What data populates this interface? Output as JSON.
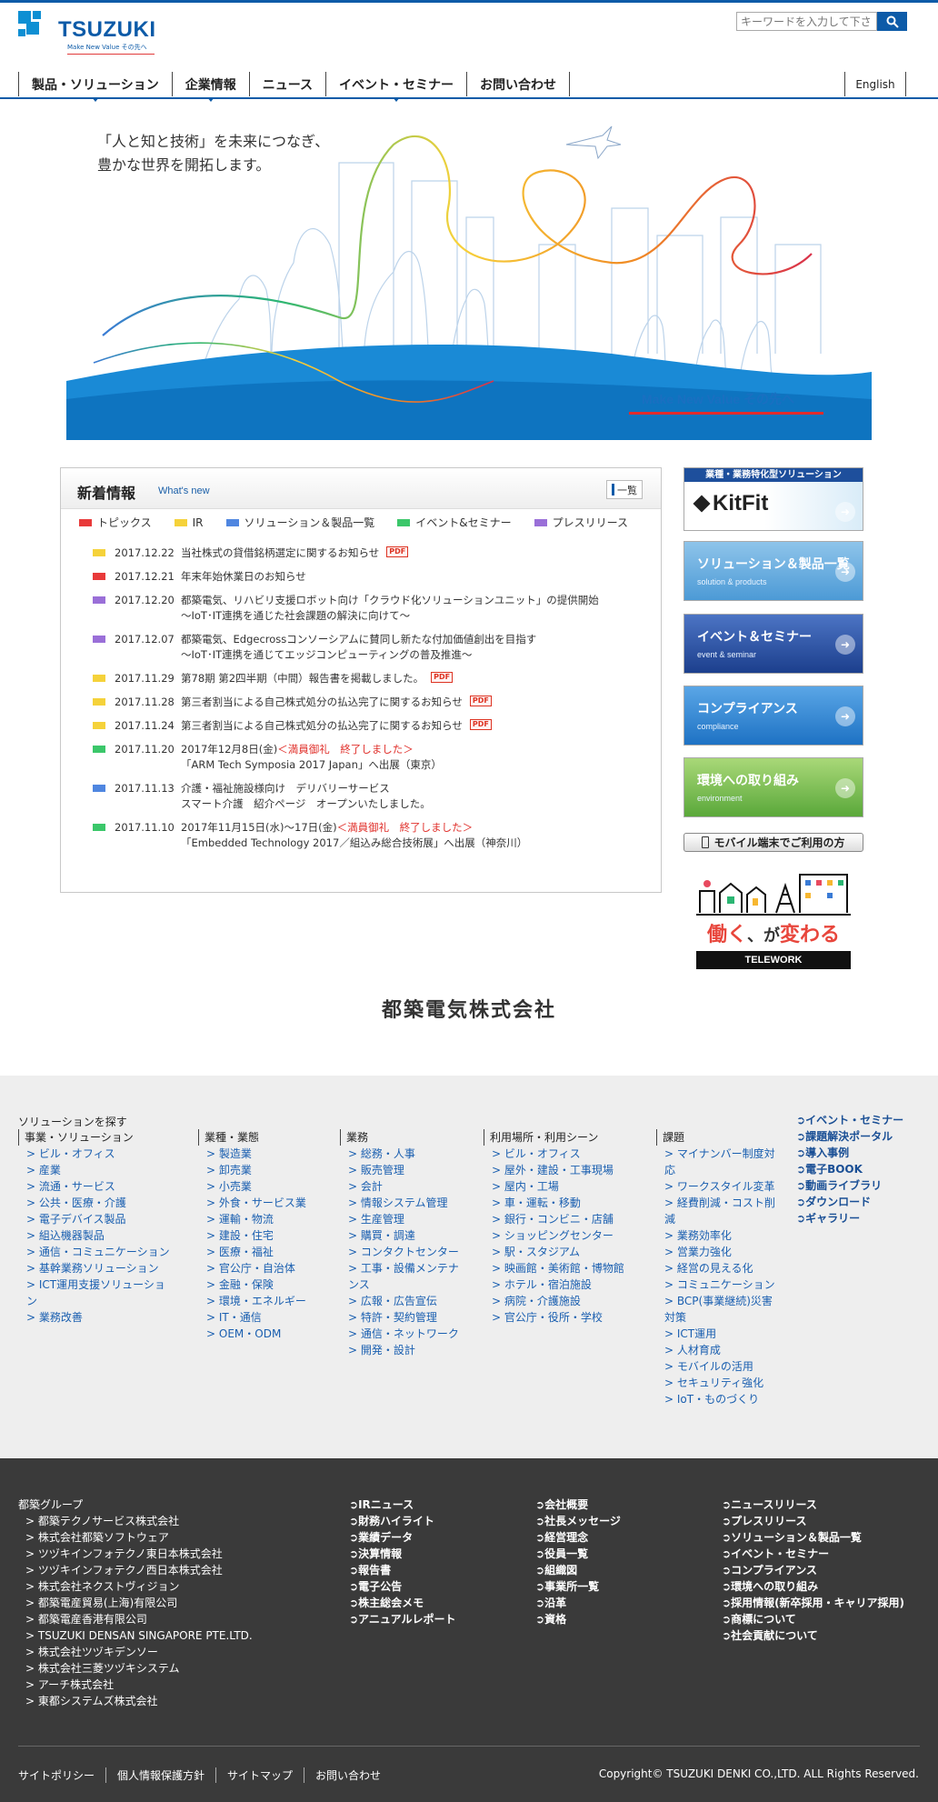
{
  "header": {
    "logo_text": "TSUZUKI",
    "logo_tagline": "Make New Value その先へ",
    "search_placeholder": "キーワードを入力して下さい",
    "english": "English"
  },
  "gnav": [
    "製品・ソリューション",
    "企業情報",
    "ニュース",
    "イベント・セミナー",
    "お問い合わせ"
  ],
  "hero": {
    "line1": "「人と知と技術」を未来につなぎ、",
    "line2": "豊かな世界を開拓します。",
    "tag": "Make New Value その先へ"
  },
  "news": {
    "title": "新着情報",
    "subtitle": "What's new",
    "list_button": "一覧",
    "categories": [
      {
        "label": "トピックス",
        "color": "#e83a3a"
      },
      {
        "label": "IR",
        "color": "#f5d23a"
      },
      {
        "label": "ソリューション＆製品一覧",
        "color": "#4f86e0"
      },
      {
        "label": "イベント&セミナー",
        "color": "#3bc76a"
      },
      {
        "label": "プレスリリース",
        "color": "#9a6fd8"
      }
    ],
    "items": [
      {
        "color": "#f5d23a",
        "date": "2017.12.22",
        "line1": "当社株式の貸借銘柄選定に関するお知らせ",
        "pdf": "PDF"
      },
      {
        "color": "#e83a3a",
        "date": "2017.12.21",
        "line1": "年末年始休業日のお知らせ"
      },
      {
        "color": "#9a6fd8",
        "date": "2017.12.20",
        "line1": "都築電気、リハビリ支援ロボット向け「クラウド化ソリューションユニット」の提供開始",
        "line2": "～IoT･IT連携を通じた社会課題の解決に向けて～"
      },
      {
        "color": "#9a6fd8",
        "date": "2017.12.07",
        "line1": "都築電気、Edgecrossコンソーシアムに賛同し新たな付加価値創出を目指す",
        "line2": "～IoT･IT連携を通じてエッジコンピューティングの普及推進～"
      },
      {
        "color": "#f5d23a",
        "date": "2017.11.29",
        "line1": "第78期 第2四半期（中間）報告書を掲載しました。",
        "pdf": "PDF"
      },
      {
        "color": "#f5d23a",
        "date": "2017.11.28",
        "line1": "第三者割当による自己株式処分の払込完了に関するお知らせ",
        "pdf": "PDF"
      },
      {
        "color": "#f5d23a",
        "date": "2017.11.24",
        "line1": "第三者割当による自己株式処分の払込完了に関するお知らせ",
        "pdf": "PDF"
      },
      {
        "color": "#3bc76a",
        "date": "2017.11.20",
        "line1": "2017年12月8日(金)",
        "red": "＜満員御礼　終了しました＞",
        "line2": "「ARM Tech Symposia 2017 Japan」へ出展（東京）"
      },
      {
        "color": "#4f86e0",
        "date": "2017.11.13",
        "line1": "介護・福祉施設様向け　デリバリーサービス",
        "line2": "スマート介護　紹介ページ　オープンいたしました。"
      },
      {
        "color": "#3bc76a",
        "date": "2017.11.10",
        "line1": "2017年11月15日(水)～17日(金)",
        "red": "＜満員御礼　終了しました＞",
        "line2": "「Embedded Technology 2017／組込み総合技術展」へ出展（神奈川）"
      }
    ]
  },
  "banners": {
    "kitfit_bar": "業種・業務特化型ソリューション",
    "kitfit_logo": "KitFit",
    "solutions": {
      "title": "ソリューション＆製品一覧",
      "sub": "solution & products"
    },
    "events": {
      "title": "イベント＆セミナー",
      "sub": "event & seminar"
    },
    "compliance": {
      "title": "コンプライアンス",
      "sub": "compliance"
    },
    "environment": {
      "title": "環境への取り組み",
      "sub": "environment"
    },
    "mobile": "モバイル端末でご利用の方",
    "telework_main": "働く",
    "telework_mid": "、が",
    "telework_end": "変わる",
    "telework_bar": "TELEWORK"
  },
  "company": "都築電気株式会社",
  "sitemap": {
    "title": "ソリューションを探す",
    "columns": [
      {
        "heading": "事業・ソリューション",
        "items": [
          "ビル・オフィス",
          "産業",
          "流通・サービス",
          "公共・医療・介護",
          "電子デバイス製品",
          "組込機器製品",
          "通信・コミュニケーション",
          "基幹業務ソリューション",
          "ICT運用支援ソリューション",
          "業務改善"
        ]
      },
      {
        "heading": "業種・業態",
        "items": [
          "製造業",
          "卸売業",
          "小売業",
          "外食・サービス業",
          "運輸・物流",
          "建設・住宅",
          "医療・福祉",
          "官公庁・自治体",
          "金融・保険",
          "環境・エネルギー",
          "IT・通信",
          "OEM・ODM"
        ]
      },
      {
        "heading": "業務",
        "items": [
          "総務・人事",
          "販売管理",
          "会計",
          "情報システム管理",
          "生産管理",
          "購買・調達",
          "コンタクトセンター",
          "工事・設備メンテナンス",
          "広報・広告宣伝",
          "特許・契約管理",
          "通信・ネットワーク",
          "開発・設計"
        ]
      },
      {
        "heading": "利用場所・利用シーン",
        "items": [
          "ビル・オフィス",
          "屋外・建設・工事現場",
          "屋内・工場",
          "車・運転・移動",
          "銀行・コンビニ・店舗",
          "ショッピングセンター",
          "駅・スタジアム",
          "映画館・美術館・博物館",
          "ホテル・宿泊施設",
          "病院・介護施設",
          "官公庁・役所・学校"
        ]
      },
      {
        "heading": "課題",
        "items": [
          "マイナンバー制度対応",
          "ワークスタイル変革",
          "経費削減・コスト削減",
          "業務効率化",
          "営業力強化",
          "経営の見える化",
          "コミュニケーション",
          "BCP(事業継続)災害対策",
          "ICT運用",
          "人材育成",
          "モバイルの活用",
          "セキュリティ強化",
          "IoT・ものづくり"
        ]
      }
    ],
    "links": [
      "イベント・セミナー",
      "課題解決ポータル",
      "導入事例",
      "電子BOOK",
      "動画ライブラリ",
      "ダウンロード",
      "ギャラリー"
    ]
  },
  "footer": {
    "group_title": "都築グループ",
    "group": [
      "都築テクノサービス株式会社",
      "株式会社都築ソフトウェア",
      "ツヅキインフォテクノ東日本株式会社",
      "ツヅキインフォテクノ西日本株式会社",
      "株式会社ネクストヴィジョン",
      "都築電産貿易(上海)有限公司",
      "都築電産香港有限公司",
      "TSUZUKI DENSAN SINGAPORE PTE.LTD.",
      "株式会社ツヅキデンソー",
      "株式会社三菱ツヅキシステム",
      "アーチ株式会社",
      "東都システムズ株式会社"
    ],
    "col_ir": [
      "IRニュース",
      "財務ハイライト",
      "業績データ",
      "決算情報",
      "報告書",
      "電子公告",
      "株主総会メモ",
      "アニュアルレポート"
    ],
    "col_company": [
      "会社概要",
      "社長メッセージ",
      "経営理念",
      "役員一覧",
      "組織図",
      "事業所一覧",
      "沿革",
      "資格"
    ],
    "col_misc": [
      "ニュースリリース",
      "プレスリリース",
      "ソリューション＆製品一覧",
      "イベント・セミナー",
      "コンプライアンス",
      "環境への取り組み",
      "採用情報(新卒採用・キャリア採用)",
      "商標について",
      "社会貢献について"
    ],
    "bottom_links": [
      "サイトポリシー",
      "個人情報保護方針",
      "サイトマップ",
      "お問い合わせ"
    ],
    "copyright": "Copyright© TSUZUKI DENKI CO.,LTD. ALL Rights Reserved."
  }
}
